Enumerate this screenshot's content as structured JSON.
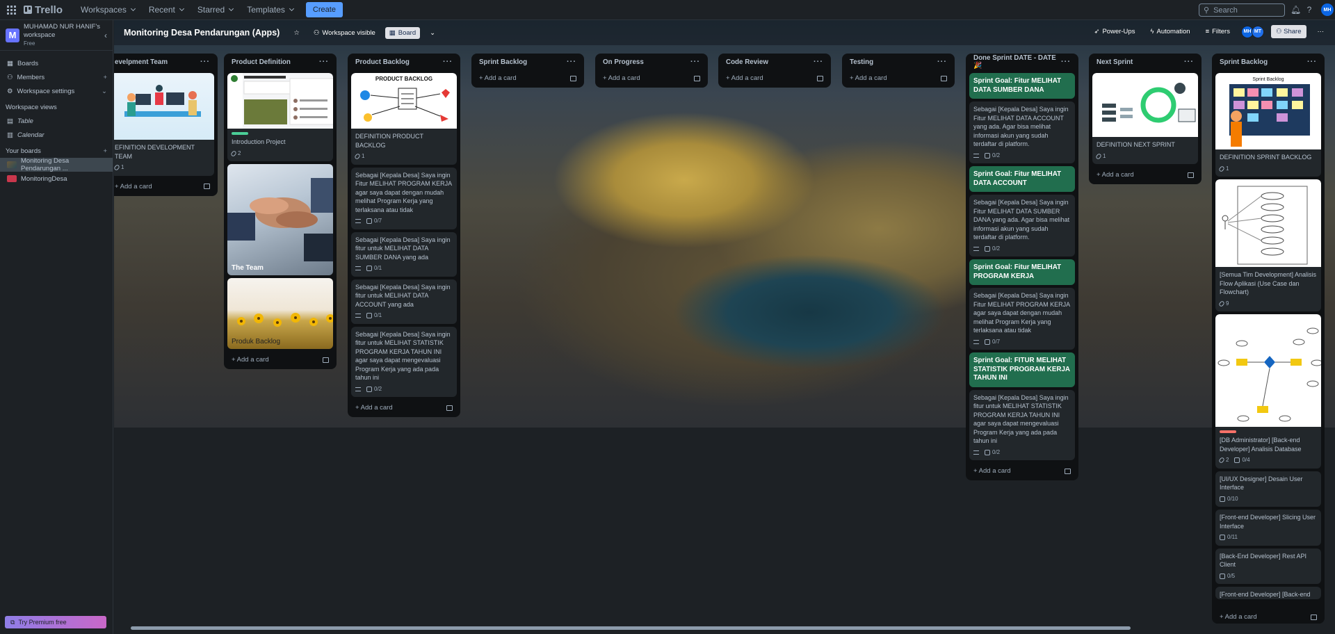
{
  "topbar": {
    "brand": "Trello",
    "nav": [
      "Workspaces",
      "Recent",
      "Starred",
      "Templates"
    ],
    "create_label": "Create",
    "search_placeholder": "Search",
    "user_initials": "MH"
  },
  "sidebar": {
    "workspace_name": "MUHAMAD NUR HANIF's workspace",
    "workspace_plan": "Free",
    "workspace_initial": "M",
    "items": [
      "Boards",
      "Members",
      "Workspace settings"
    ],
    "views_title": "Workspace views",
    "views": [
      "Table",
      "Calendar"
    ],
    "boards_title": "Your boards",
    "boards": [
      "Monitoring Desa Pendarungan ...",
      "MonitoringDesa"
    ],
    "premium_label": "Try Premium free"
  },
  "board": {
    "title": "Monitoring Desa Pendarungan (Apps)",
    "visibility": "Workspace visible",
    "view": "Board",
    "powerups": "Power-Ups",
    "automation": "Automation",
    "filters": "Filters",
    "members": [
      "MH",
      "MT"
    ],
    "share": "Share",
    "add_card": "Add a card"
  },
  "lists": [
    {
      "title": "evelpment Team",
      "cards": [
        {
          "title": "EFINITION DEVELOPMENT TEAM",
          "attach": "1"
        }
      ]
    },
    {
      "title": "Product Definition",
      "cards": [
        {
          "title": "Introduction Project",
          "attach": "2"
        },
        {
          "title": "The Team"
        },
        {
          "title": "Produk Backlog"
        }
      ]
    },
    {
      "title": "Product Backlog",
      "cover_text": "PRODUCT BACKLOG",
      "cards": [
        {
          "title": "DEFINITION PRODUCT BACKLOG",
          "attach": "1"
        },
        {
          "title": "Sebagai [Kepala Desa] Saya ingin Fitur MELIHAT PROGRAM KERJA agar saya dapat dengan mudah melihat Program Kerja yang terlaksana atau tidak",
          "check": "0/7"
        },
        {
          "title": "Sebagai [Kepala Desa] Saya ingin fitur untuk MELIHAT DATA SUMBER DANA yang ada",
          "check": "0/1"
        },
        {
          "title": "Sebagai [Kepala Desa] Saya ingin fitur untuk MELIHAT DATA ACCOUNT yang ada",
          "check": "0/1"
        },
        {
          "title": "Sebagai [Kepala Desa] Saya ingin fitur untuk MELIHAT STATISTIK PROGRAM KERJA TAHUN INI agar saya dapat mengevaluasi Program Kerja yang ada pada tahun ini",
          "check": "0/2"
        }
      ]
    },
    {
      "title": "Sprint Backlog"
    },
    {
      "title": "On Progress"
    },
    {
      "title": "Code Review"
    },
    {
      "title": "Testing"
    },
    {
      "title": "Done Sprint DATE - DATE 🎉",
      "cards": [
        {
          "title": "Sprint Goal: Fitur MELIHAT DATA SUMBER DANA",
          "green": true
        },
        {
          "title": "Sebagai [Kepala Desa] Saya ingin Fitur MELIHAT DATA ACCOUNT yang ada. Agar bisa melihat informasi akun yang sudah terdaftar di platform.",
          "check": "0/2"
        },
        {
          "title": "Sprint Goal: Fitur MELIHAT DATA ACCOUNT",
          "green": true
        },
        {
          "title": "Sebagai [Kepala Desa] Saya ingin Fitur MELIHAT DATA SUMBER DANA yang ada. Agar bisa melihat informasi akun yang sudah terdaftar di platform.",
          "check": "0/2"
        },
        {
          "title": "Sprint Goal: Fitur MELIHAT PROGRAM KERJA",
          "green": true
        },
        {
          "title": "Sebagai [Kepala Desa] Saya ingin Fitur MELIHAT PROGRAM KERJA agar saya dapat dengan mudah melihat Program Kerja yang terlaksana atau tidak",
          "check": "0/7"
        },
        {
          "title": "Sprint Goal: FITUR MELIHAT STATISTIK PROGRAM KERJA TAHUN INI",
          "green": true
        },
        {
          "title": "Sebagai [Kepala Desa] Saya ingin fitur untuk MELIHAT STATISTIK PROGRAM KERJA TAHUN INI agar saya dapat mengevaluasi Program Kerja yang ada pada tahun ini",
          "check": "0/2"
        }
      ]
    },
    {
      "title": "Next Sprint",
      "cards": [
        {
          "title": "DEFINITION NEXT SPRINT",
          "attach": "1"
        }
      ]
    },
    {
      "title": "Sprint Backlog",
      "cover_text": "Sprint Backlog",
      "cards": [
        {
          "title": "DEFINITION SPRINT BACKLOG",
          "attach": "1"
        },
        {
          "title": "[Semua Tim Development] Analisis Flow Aplikasi (Use Case dan Flowchart)",
          "attach": "9"
        },
        {
          "title": "[DB Administrator] [Back-end Developer] Analisis Database",
          "attach": "2",
          "check": "0/4"
        },
        {
          "title": "[UI/UX Designer] Desain User Interface",
          "check": "0/10"
        },
        {
          "title": "[Front-end Developer] Slicing User Interface",
          "check": "0/11"
        },
        {
          "title": "[Back-End Developer] Rest API Client",
          "check": "0/5"
        },
        {
          "title": "[Front-end Developer] [Back-end"
        }
      ]
    }
  ],
  "colors": {
    "green_card": "#216e4e",
    "label_green": "#4bce97",
    "label_red": "#f87168",
    "accent": "#579dff"
  }
}
